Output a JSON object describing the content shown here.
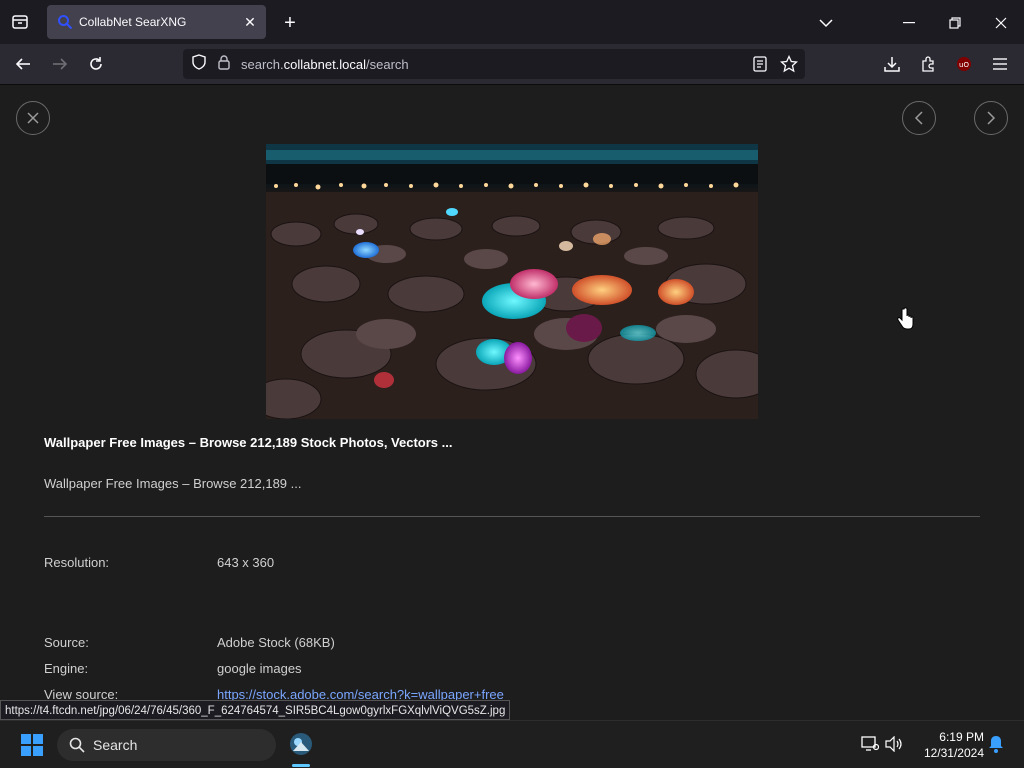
{
  "browser": {
    "tab_title": "CollabNet SearXNG",
    "url_prefix": "search.",
    "url_host": "collabnet.local",
    "url_path": "/search"
  },
  "result": {
    "title": "Wallpaper Free Images – Browse 212,189 Stock Photos, Vectors ...",
    "description": "Wallpaper Free Images – Browse 212,189 ...",
    "resolution_label": "Resolution:",
    "resolution_value": "643 x 360",
    "source_label": "Source:",
    "source_value": "Adobe Stock (68KB)",
    "engine_label": "Engine:",
    "engine_value": "google images",
    "view_source_label": "View source:",
    "view_source_value": "https://stock.adobe.com/search?k=wallpaper+free"
  },
  "status_url": "https://t4.ftcdn.net/jpg/06/24/76/45/360_F_624764574_SIR5BC4Lgow0gyrlxFGXqlvlViQVG5sZ.jpg",
  "taskbar": {
    "search_label": "Search",
    "time": "6:19 PM",
    "date": "12/31/2024"
  },
  "icons": {
    "close": "close-icon",
    "prev": "chevron-left-icon",
    "next": "chevron-right-icon"
  }
}
